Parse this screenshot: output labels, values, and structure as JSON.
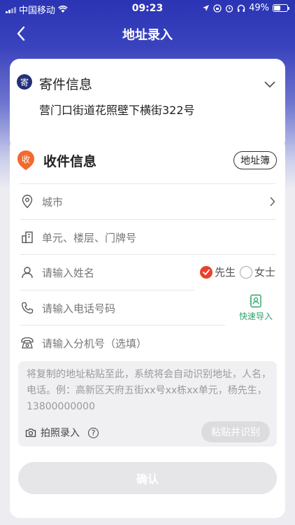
{
  "statusbar": {
    "carrier": "中国移动",
    "time": "09:23",
    "battery": "49%",
    "battery_level": 0.49
  },
  "nav": {
    "title": "地址录入",
    "back_icon": "chevron-left-icon"
  },
  "sender": {
    "icon_text": "寄",
    "title": "寄件信息",
    "address": "营门口街道花照壁下横街322号"
  },
  "receiver": {
    "icon_text": "收",
    "title": "收件信息",
    "address_book_label": "地址簿",
    "city_placeholder": "城市",
    "unit_placeholder": "单元、楼层、门牌号",
    "name_placeholder": "请输入姓名",
    "gender_male": "先生",
    "gender_female": "女士",
    "gender_selected": "先生",
    "phone_placeholder": "请输入电话号码",
    "quick_import_label": "快速导入",
    "ext_placeholder": "请输入分机号（选填）",
    "paste_hint": "将复制的地址粘贴至此，系统将会自动识别地址，人名，电话。例：高新区天府五街xx号xx栋xx单元，杨先生，13800000000",
    "photo_entry_label": "拍照录入",
    "help_symbol": "?",
    "paste_button_label": "粘贴并识别",
    "confirm_label": "确认"
  },
  "colors": {
    "brand_blue": "#2a34b4",
    "accent_red": "#e8422d",
    "accent_orange": "#f26a2d",
    "quick_import_green": "#2fa36b"
  }
}
